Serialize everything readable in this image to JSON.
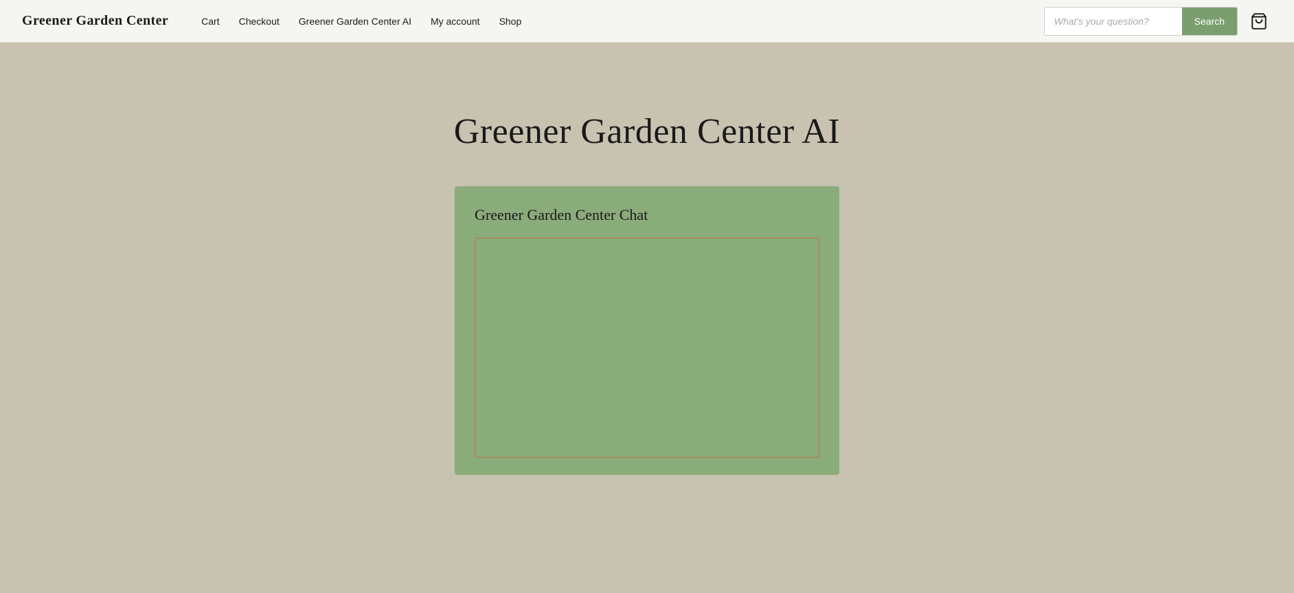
{
  "site": {
    "title": "Greener Garden Center"
  },
  "navbar": {
    "nav_links": [
      {
        "id": "cart",
        "label": "Cart"
      },
      {
        "id": "checkout",
        "label": "Checkout"
      },
      {
        "id": "ai",
        "label": "Greener Garden Center AI"
      },
      {
        "id": "my-account",
        "label": "My account"
      },
      {
        "id": "shop",
        "label": "Shop"
      }
    ]
  },
  "search": {
    "placeholder": "What's your question?",
    "button_label": "Search"
  },
  "main": {
    "page_title": "Greener Garden Center AI",
    "chat_title": "Greener Garden Center Chat"
  }
}
